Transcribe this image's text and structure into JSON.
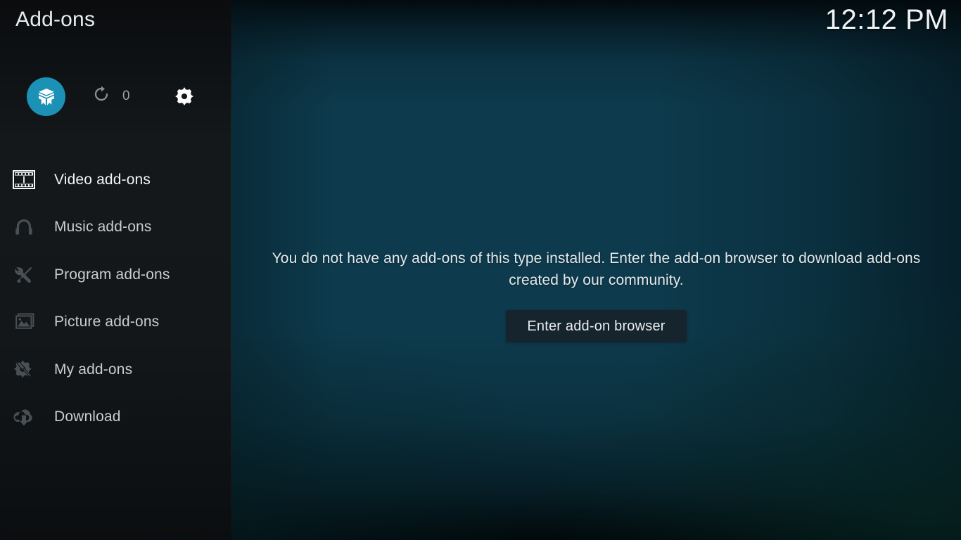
{
  "header": {
    "title": "Add-ons",
    "clock": "12:12 PM"
  },
  "top_actions": {
    "package_button": {
      "icon": "package-box-icon",
      "accent_color": "#1c91b6"
    },
    "updates": {
      "icon": "refresh-icon",
      "count": "0"
    },
    "settings": {
      "icon": "gear-icon",
      "label": "Settings"
    }
  },
  "sidebar": {
    "items": [
      {
        "label": "Video add-ons",
        "icon": "film-strip-icon",
        "focused": true
      },
      {
        "label": "Music add-ons",
        "icon": "headphones-icon",
        "focused": false
      },
      {
        "label": "Program add-ons",
        "icon": "wrench-pencil-icon",
        "focused": false
      },
      {
        "label": "Picture add-ons",
        "icon": "picture-icon",
        "focused": false
      },
      {
        "label": "My add-ons",
        "icon": "gear-screwdriver-icon",
        "focused": false
      },
      {
        "label": "Download",
        "icon": "cloud-download-icon",
        "focused": false
      }
    ]
  },
  "content": {
    "empty_message": "You do not have any add-ons of this type installed. Enter the add-on browser to download add-ons created by our community.",
    "browser_button_label": "Enter add-on browser"
  },
  "colors": {
    "accent": "#1c91b6",
    "sidebar_bg": "#14181b",
    "background_teal": "#15566c",
    "button_bg": "#15242d",
    "text_primary": "#e9eced",
    "text_dim": "#9ca2a6"
  }
}
